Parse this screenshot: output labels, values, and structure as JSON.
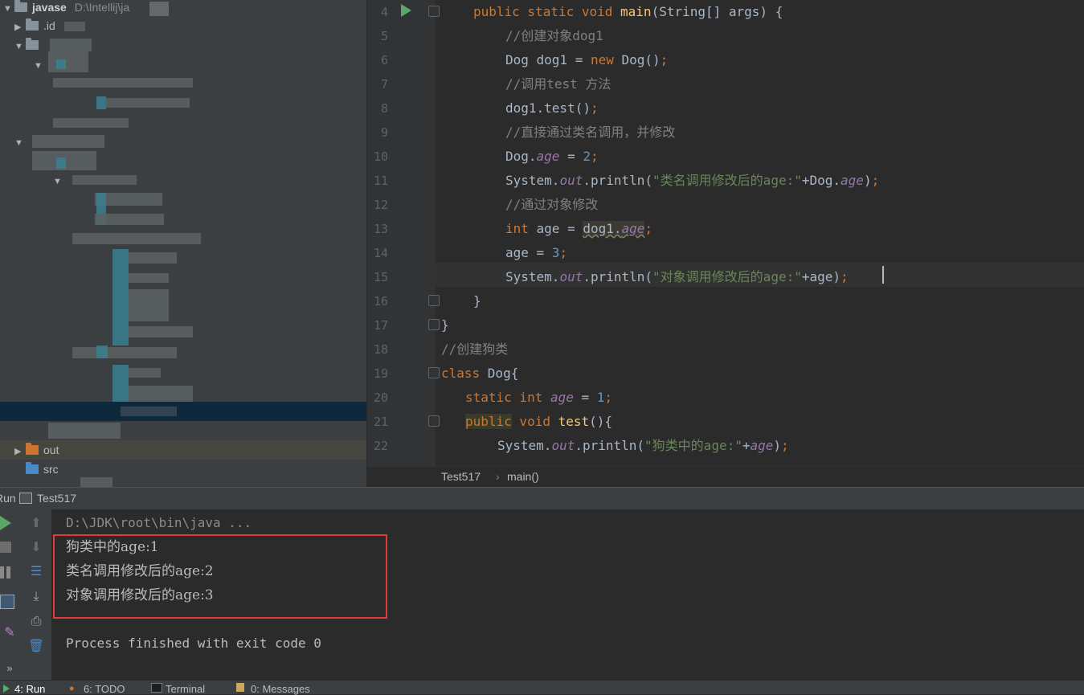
{
  "project_tree": {
    "root": {
      "name": "javase",
      "path": "D:\\Intellij\\ja"
    },
    "idea_folder": ".id",
    "out_folder": "out",
    "src_folder": "src"
  },
  "editor": {
    "line_numbers": [
      "4",
      "5",
      "6",
      "7",
      "8",
      "9",
      "10",
      "11",
      "12",
      "13",
      "14",
      "15",
      "16",
      "17",
      "18",
      "19",
      "20",
      "21",
      "22"
    ],
    "breadcrumb": {
      "class_name": "Test517",
      "method_name": "main()"
    }
  },
  "run_panel": {
    "title": "Run",
    "config_name": "Test517",
    "console": {
      "command": "D:\\JDK\\root\\bin\\java ...",
      "output": [
        "狗类中的age:1",
        "类名调用修改后的age:2",
        "对象调用修改后的age:3"
      ],
      "exit_message": "Process finished with exit code 0"
    }
  },
  "bottom_tabs": [
    {
      "label": "4: Run"
    },
    {
      "label": "6: TODO"
    },
    {
      "label": "Terminal"
    },
    {
      "label": "0: Messages"
    }
  ],
  "colors": {
    "keyword": "#CC7832",
    "method": "#FFC66D",
    "comment": "#808080",
    "string": "#6A8759",
    "number": "#6897BB",
    "static_field": "#9876AA",
    "highlight_box": "#E03C3C"
  }
}
